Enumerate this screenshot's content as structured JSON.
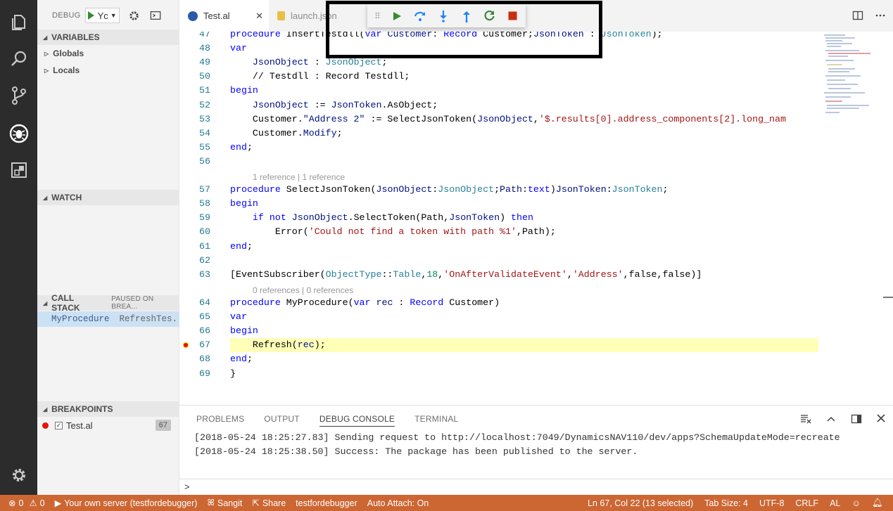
{
  "sidebar": {
    "debug_label": "DEBUG",
    "config_name": "Yc",
    "sections": {
      "variables": "VARIABLES",
      "watch": "WATCH",
      "call_stack": "CALL STACK",
      "call_stack_status": "PAUSED ON BREA...",
      "breakpoints": "BREAKPOINTS"
    },
    "variables": [
      {
        "label": "Globals"
      },
      {
        "label": "Locals"
      }
    ],
    "call_stack": [
      {
        "fn": "MyProcedure",
        "file": "RefreshTes..."
      }
    ],
    "breakpoints": [
      {
        "file": "Test.al",
        "line": "67"
      }
    ]
  },
  "tabs": [
    {
      "label": "Test.al",
      "active": true
    },
    {
      "label": "launch.json",
      "active": false
    }
  ],
  "editor": {
    "current_line": "67",
    "lines": [
      {
        "n": "47",
        "text": "procedure InsertTestdll(Var Customer: Record Customer;JsonToken : JsonToken);"
      },
      {
        "n": "48",
        "text": "var"
      },
      {
        "n": "49",
        "text": "    JsonObject : JsonObject;"
      },
      {
        "n": "50",
        "text": "    // Testdll : Record Testdll;"
      },
      {
        "n": "51",
        "text": "begin"
      },
      {
        "n": "52",
        "text": "    JsonObject := JsonToken.AsObject;"
      },
      {
        "n": "53",
        "text": "    Customer.\"Address 2\" := SelectJsonToken(JsonObject,'$.results[0].address_components[2].long_nam"
      },
      {
        "n": "54",
        "text": "    Customer.Modify;"
      },
      {
        "n": "55",
        "text": "end;"
      },
      {
        "n": "56",
        "text": ""
      },
      {
        "n": "57",
        "text": "procedure SelectJsonToken(JsonObject:JsonObject;Path:text)JsonToken:JsonToken;"
      },
      {
        "n": "58",
        "text": "begin"
      },
      {
        "n": "59",
        "text": "    if not JsonObject.SelectToken(Path,JsonToken) then"
      },
      {
        "n": "60",
        "text": "        Error('Could not find a token with path %1',Path);"
      },
      {
        "n": "61",
        "text": "end;"
      },
      {
        "n": "62",
        "text": ""
      },
      {
        "n": "63",
        "text": "[EventSubscriber(ObjectType::Table,18,'OnAfterValidateEvent','Address',false,false)]"
      },
      {
        "n": "64",
        "text": "procedure MyProcedure(var rec : Record Customer)"
      },
      {
        "n": "65",
        "text": "var"
      },
      {
        "n": "66",
        "text": "begin"
      },
      {
        "n": "67",
        "text": "    Refresh(rec);"
      },
      {
        "n": "68",
        "text": "end;"
      },
      {
        "n": "69",
        "text": "}"
      }
    ],
    "codelens_1": "1 reference | 1 reference",
    "codelens_2": "0 references | 0 references"
  },
  "panel": {
    "tabs": [
      "PROBLEMS",
      "OUTPUT",
      "DEBUG CONSOLE",
      "TERMINAL"
    ],
    "active_tab": "DEBUG CONSOLE",
    "console": [
      "[2018-05-24 18:25:27.83] Sending request to http://localhost:7049/DynamicsNAV110/dev/apps?SchemaUpdateMode=recreate",
      "[2018-05-24 18:25:38.50] Success: The package has been published to the server."
    ],
    "prompt": ">"
  },
  "statusbar": {
    "errors": "0",
    "warnings": "0",
    "server": "Your own server (testfordebugger)",
    "user": "Sangit",
    "share": "Share",
    "workspace": "testfordebugger",
    "auto_attach": "Auto Attach: On",
    "position": "Ln 67, Col 22 (13 selected)",
    "tab_size": "Tab Size: 4",
    "encoding": "UTF-8",
    "eol": "CRLF",
    "language": "AL",
    "bg_color": "#cc6633"
  },
  "icons": [
    "explorer-icon",
    "search-icon",
    "source-control-icon",
    "debug-icon",
    "extensions-icon",
    "settings-gear-icon",
    "continue-icon",
    "step-over-icon",
    "step-into-icon",
    "step-out-icon",
    "restart-icon",
    "stop-icon"
  ]
}
